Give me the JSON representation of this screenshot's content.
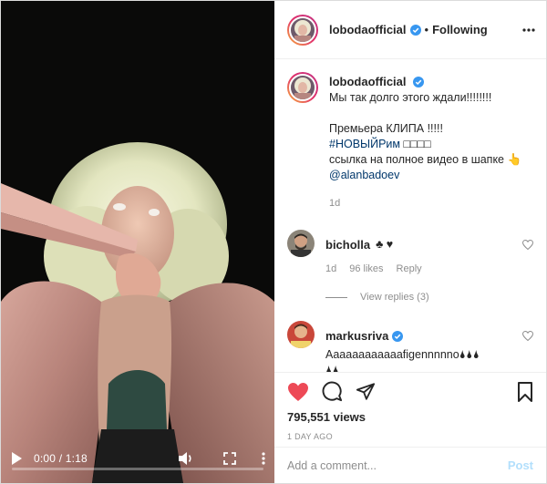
{
  "video": {
    "time": "0:00 / 1:18",
    "progress_fraction": 0.0,
    "icons": [
      "play-icon",
      "volume-icon",
      "fullscreen-icon",
      "more-vertical-icon"
    ]
  },
  "header": {
    "username": "lobodaofficial",
    "separator": "•",
    "follow_label": "Following"
  },
  "caption": {
    "username": "lobodaofficial",
    "lines": [
      "Мы так долго этого ждали!!!!!!!!",
      "",
      "Премьера КЛИПА !!!!!",
      "#НОВЫЙРим □□□□",
      "ссылка на полное видео в шапке 👆",
      "@alanbadoev"
    ],
    "hashtag": "#НОВЫЙРим",
    "hashtag_rest": " □□□□",
    "mention": "@alanbadoev",
    "age": "1d"
  },
  "comments": [
    {
      "username": "bicholla",
      "text": "♣ ♥",
      "age": "1d",
      "likes": "96 likes",
      "reply_label": "Reply",
      "view_replies": "View replies (3)"
    },
    {
      "username": "markusriva",
      "text_line1": "Aaaaaaaaaaaafigennnnno🌢🌢🌢",
      "text_line2": "🌢🌢"
    }
  ],
  "stats": {
    "views": "795,551 views",
    "time_ago": "1 DAY AGO"
  },
  "composer": {
    "placeholder": "Add a comment...",
    "post_label": "Post"
  },
  "colors": {
    "like_red": "#ed4956",
    "link_blue": "#00376b",
    "verified_blue": "#3897f0",
    "post_disabled": "#b2dffc"
  }
}
